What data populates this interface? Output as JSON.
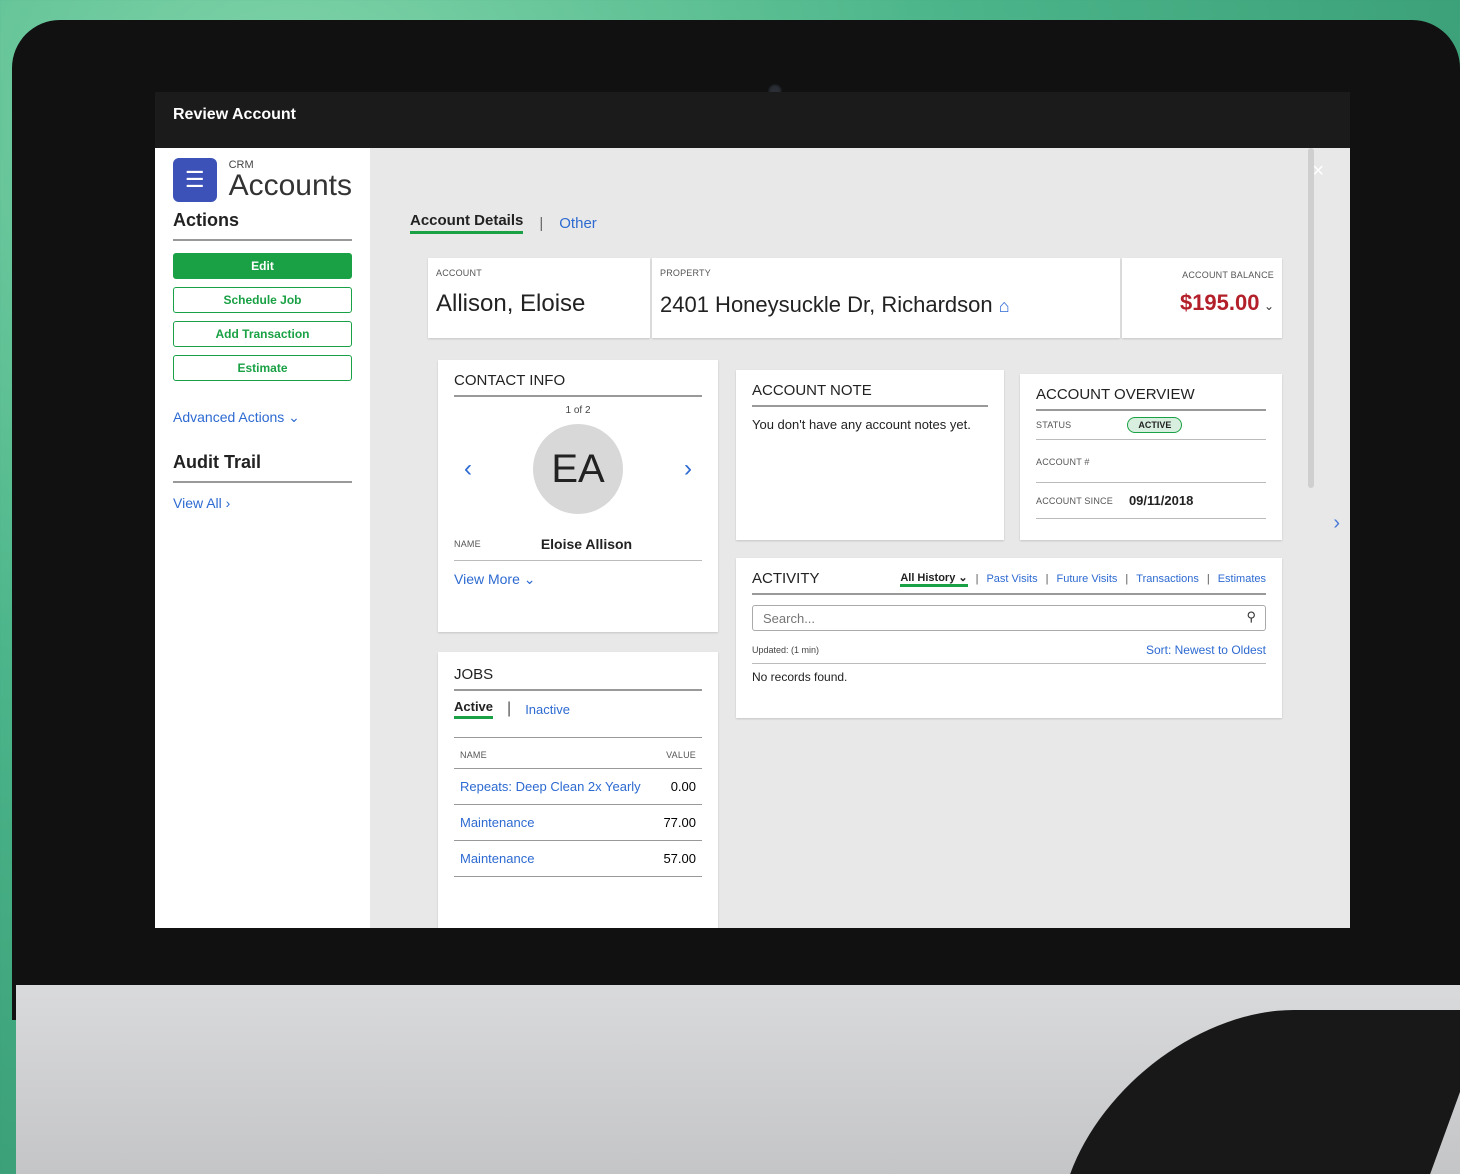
{
  "window": {
    "title": "Review Account",
    "close_icon": "×"
  },
  "sidebar": {
    "crm_label": "CRM",
    "title": "Accounts",
    "actions_heading": "Actions",
    "buttons": {
      "edit": "Edit",
      "schedule_job": "Schedule Job",
      "add_transaction": "Add Transaction",
      "estimate": "Estimate"
    },
    "advanced_actions": "Advanced Actions ⌄",
    "audit_heading": "Audit Trail",
    "view_all": "View All ›"
  },
  "tabs": {
    "account_details": "Account Details",
    "separator": "|",
    "other": "Other"
  },
  "header": {
    "account_label": "ACCOUNT",
    "account_name": "Allison, Eloise",
    "property_label": "PROPERTY",
    "property_address": "2401 Honeysuckle Dr, Richardson",
    "balance_label": "ACCOUNT BALANCE",
    "balance_value": "$195.00",
    "balance_chevron": "⌄"
  },
  "contact": {
    "heading": "CONTACT INFO",
    "pager": "1 of 2",
    "initials": "EA",
    "name_label": "NAME",
    "name_value": "Eloise Allison",
    "view_more": "View More ⌄"
  },
  "note": {
    "heading": "ACCOUNT NOTE",
    "text": "You don't have any account notes yet."
  },
  "overview": {
    "heading": "ACCOUNT OVERVIEW",
    "status_label": "STATUS",
    "status_value": "ACTIVE",
    "account_num_label": "ACCOUNT #",
    "since_label": "ACCOUNT SINCE",
    "since_value": "09/11/2018"
  },
  "activity": {
    "heading": "ACTIVITY",
    "tabs": {
      "all": "All History ⌄",
      "past": "Past Visits",
      "future": "Future Visits",
      "transactions": "Transactions",
      "estimates": "Estimates"
    },
    "search_placeholder": "Search...",
    "updated": "Updated: (1 min)",
    "sort": "Sort: Newest to Oldest",
    "empty": "No records found."
  },
  "jobs": {
    "heading": "JOBS",
    "tab_active": "Active",
    "tab_inactive": "Inactive",
    "col_name": "NAME",
    "col_value": "VALUE",
    "rows": [
      {
        "name": "Repeats: Deep Clean 2x Yearly",
        "value": "0.00"
      },
      {
        "name": "Maintenance",
        "value": "77.00"
      },
      {
        "name": "Maintenance",
        "value": "57.00"
      }
    ]
  },
  "colors": {
    "accent_green": "#1aa145",
    "link_blue": "#2d6ad1",
    "balance_red": "#b3202a"
  }
}
